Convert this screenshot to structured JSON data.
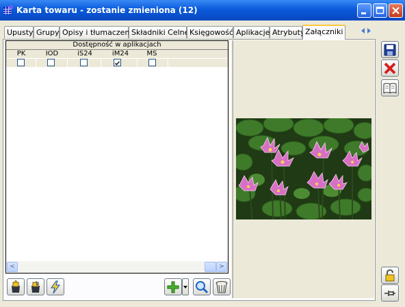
{
  "window": {
    "title": "Karta towaru - zostanie zmieniona (12)",
    "icon": "grid-app-icon",
    "controls": [
      "minimize-icon",
      "maximize-icon",
      "close-icon"
    ]
  },
  "tabs": [
    {
      "label": "Upusty"
    },
    {
      "label": "Grupy"
    },
    {
      "label": "Opisy i tłumaczenia"
    },
    {
      "label": "Składniki Celne"
    },
    {
      "label": "Księgowość"
    },
    {
      "label": "Aplikacje"
    },
    {
      "label": "Atrybuty"
    },
    {
      "label": "Załączniki",
      "active": true
    }
  ],
  "grid": {
    "group_header": "Dostępność w aplikacjach",
    "columns": [
      {
        "label": "PK",
        "checked": false
      },
      {
        "label": "IOD",
        "checked": false
      },
      {
        "label": "iS24",
        "checked": false
      },
      {
        "label": "iM24",
        "checked": true
      },
      {
        "label": "MS",
        "checked": false
      }
    ]
  },
  "left_toolbar": [
    "attach-icon",
    "attach-alt-icon",
    "lightning-icon"
  ],
  "right_toolbar": [
    "add-icon",
    "dropdown-arrow-icon",
    "magnifier-icon",
    "trash-icon"
  ],
  "side_toolbar": [
    "save-icon",
    "cancel-icon",
    "book-icon",
    "lock-icon",
    "pin-icon"
  ],
  "colors": {
    "title_blue": "#0a5adb",
    "tab_highlight": "#ffc83c",
    "cancel_red": "#d42020"
  }
}
